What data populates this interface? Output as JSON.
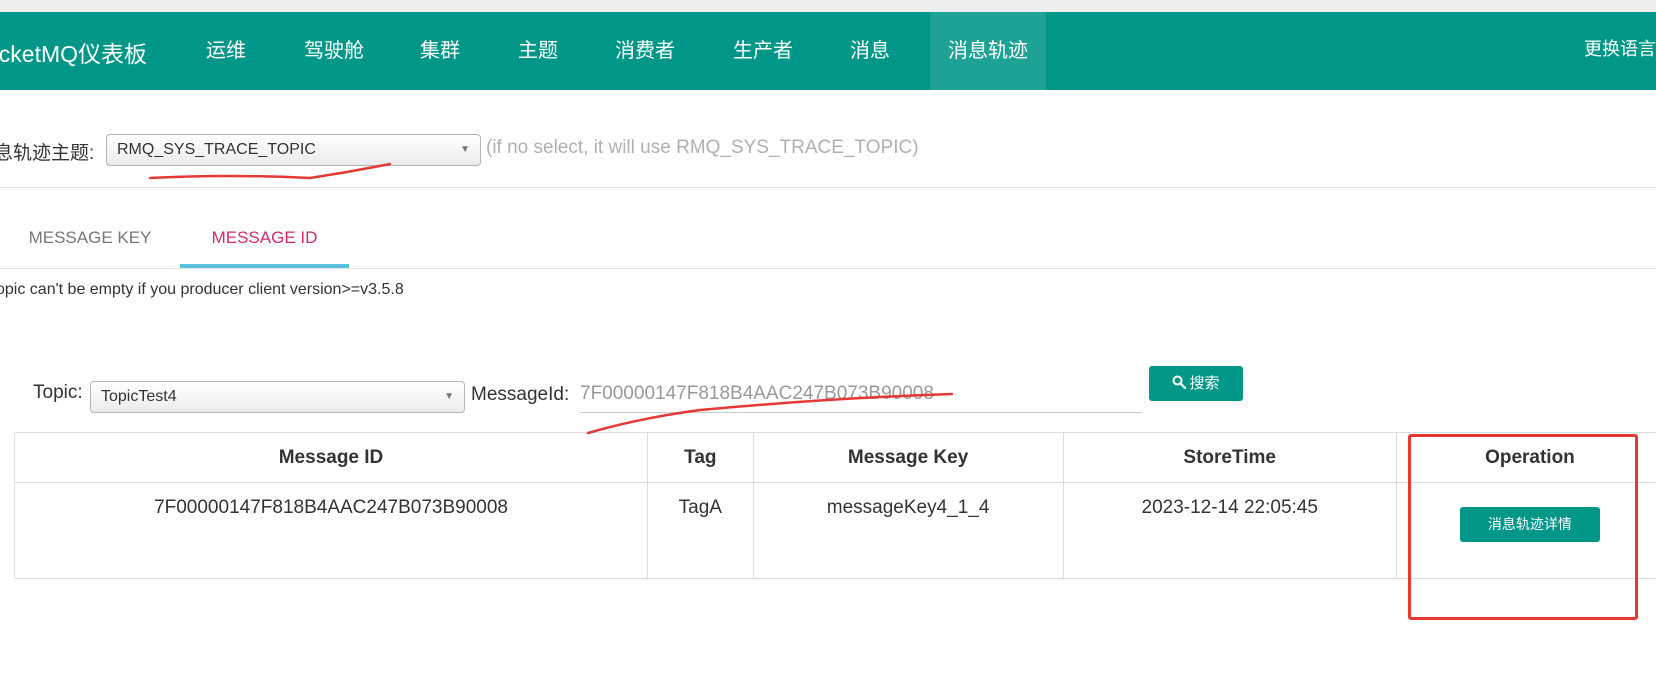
{
  "header": {
    "brand": "ocketMQ仪表板",
    "nav": [
      "运维",
      "驾驶舱",
      "集群",
      "主题",
      "消费者",
      "生产者",
      "消息",
      "消息轨迹"
    ],
    "active_nav": "消息轨迹",
    "language_button": "更换语言"
  },
  "trace_topic": {
    "label": "息轨迹主题:",
    "selected": "RMQ_SYS_TRACE_TOPIC",
    "hint": "(if no select, it will use RMQ_SYS_TRACE_TOPIC)"
  },
  "tabs": [
    {
      "label": "MESSAGE KEY",
      "active": false
    },
    {
      "label": "MESSAGE ID",
      "active": true
    }
  ],
  "warning": "opic can't be empty if you producer client version>=v3.5.8",
  "query": {
    "topic_label": "Topic:",
    "topic_value": "TopicTest4",
    "messageid_label": "MessageId:",
    "messageid_value": "7F00000147F818B4AAC247B073B90008",
    "search_button": "搜索"
  },
  "table": {
    "columns": [
      "Message ID",
      "Tag",
      "Message Key",
      "StoreTime",
      "Operation"
    ],
    "rows": [
      {
        "message_id": "7F00000147F818B4AAC247B073B90008",
        "tag": "TagA",
        "message_key": "messageKey4_1_4",
        "store_time": "2023-12-14 22:05:45",
        "action": "消息轨迹详情"
      }
    ]
  },
  "colors": {
    "primary": "#009688",
    "active_tab_text": "#d62a6b",
    "tab_underline": "#5bc0de",
    "annotation_red": "#e53935"
  }
}
